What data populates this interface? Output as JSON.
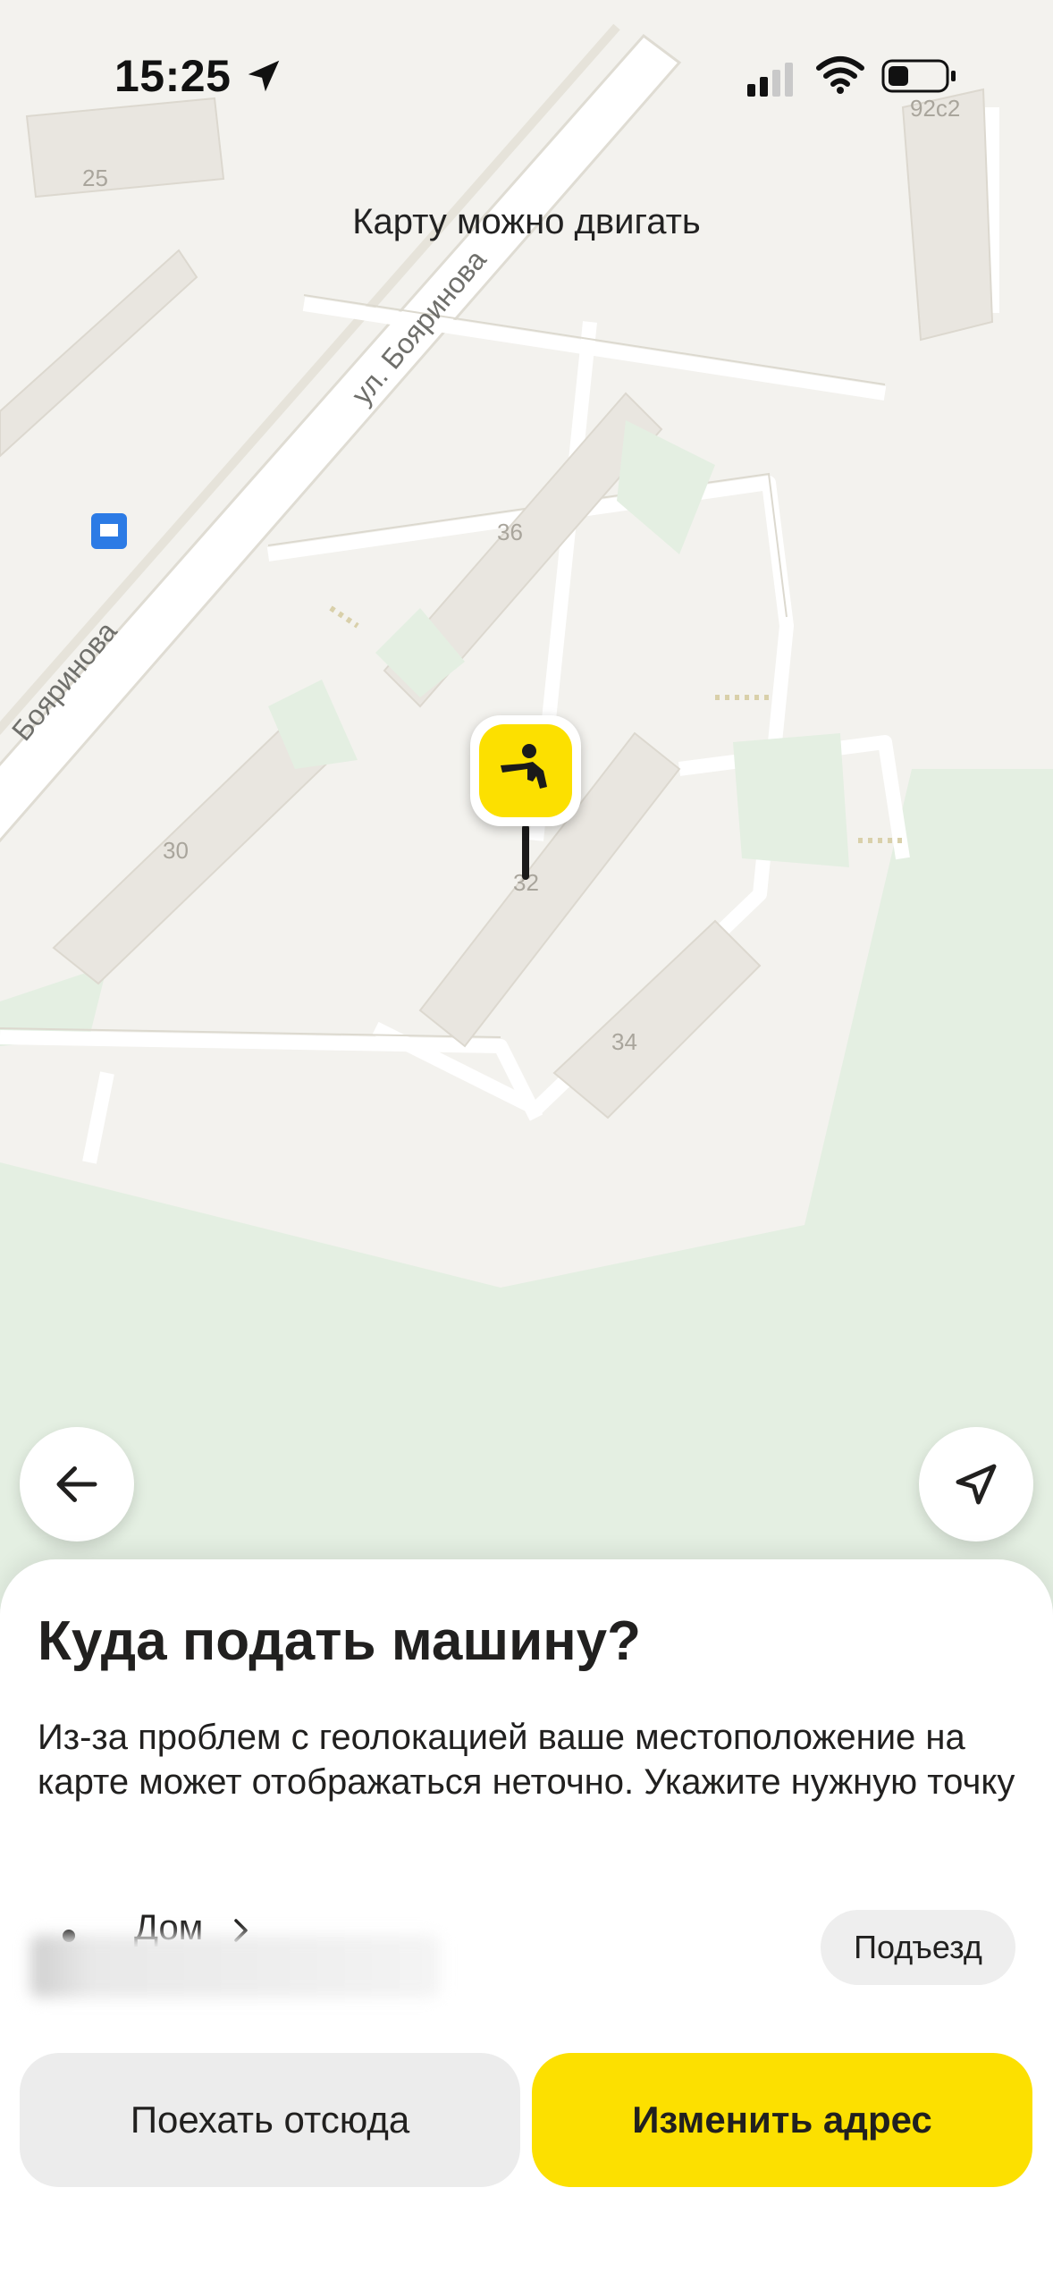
{
  "status_bar": {
    "time": "15:25",
    "location_icon": "location-arrow-icon",
    "signal_icon": "cellular-signal-icon",
    "wifi_icon": "wifi-icon",
    "battery_icon": "battery-icon"
  },
  "map": {
    "hint": "Карту можно двигать",
    "streets": [
      "ул. Бояринова",
      "Бояринова"
    ],
    "house_numbers": [
      "25",
      "92с2",
      "36",
      "30",
      "32",
      "34"
    ],
    "pin_icon": "person-waving-taxi-icon",
    "bus_stop_icon": "bus-stop-icon",
    "colors": {
      "land": "#f3f2ee",
      "park": "#e4efe2",
      "building": "#e9e6e0",
      "pin": "#fce000"
    }
  },
  "controls": {
    "back_icon": "arrow-left-icon",
    "locate_icon": "navigation-arrow-icon"
  },
  "sheet": {
    "title": "Куда подать машину?",
    "description": "Из-за проблем с геолокацией ваше местоположение на карте может отображаться неточно. Укажите нужную точку",
    "address_label": "Дом",
    "entrance_button": "Подъезд",
    "secondary_button": "Поехать отсюда",
    "primary_button": "Изменить адрес"
  }
}
